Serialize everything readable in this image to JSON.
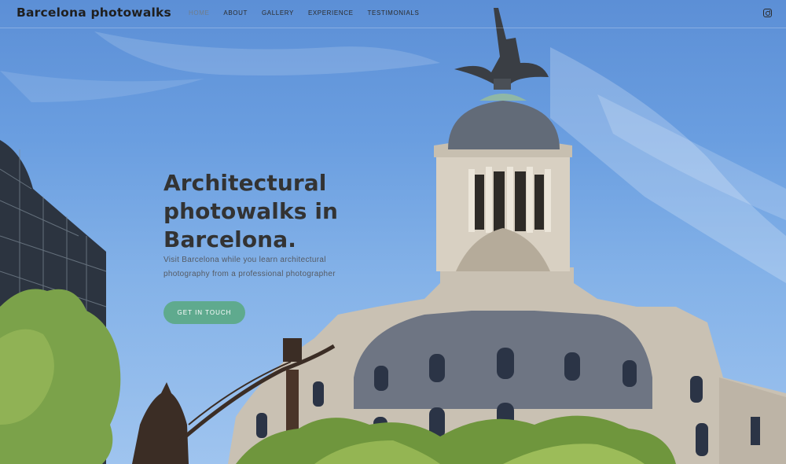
{
  "header": {
    "brand": "Barcelona photowalks",
    "nav": [
      "HOME",
      "ABOUT",
      "GALLERY",
      "EXPERIENCE",
      "TESTIMONIALS"
    ],
    "active_nav": "HOME",
    "social_icon": "instagram-icon"
  },
  "hero": {
    "headline_1": "Architectural",
    "headline_2": "photowalks in",
    "headline_3": "Barcelona.",
    "sub_1": "Visit Barcelona while you learn architectural",
    "sub_2": "photography from a professional photographer",
    "cta_label": "GET IN TOUCH"
  },
  "colors": {
    "accent": "#5faa8e",
    "sky": "#6a9ee0",
    "headline": "#333333"
  }
}
